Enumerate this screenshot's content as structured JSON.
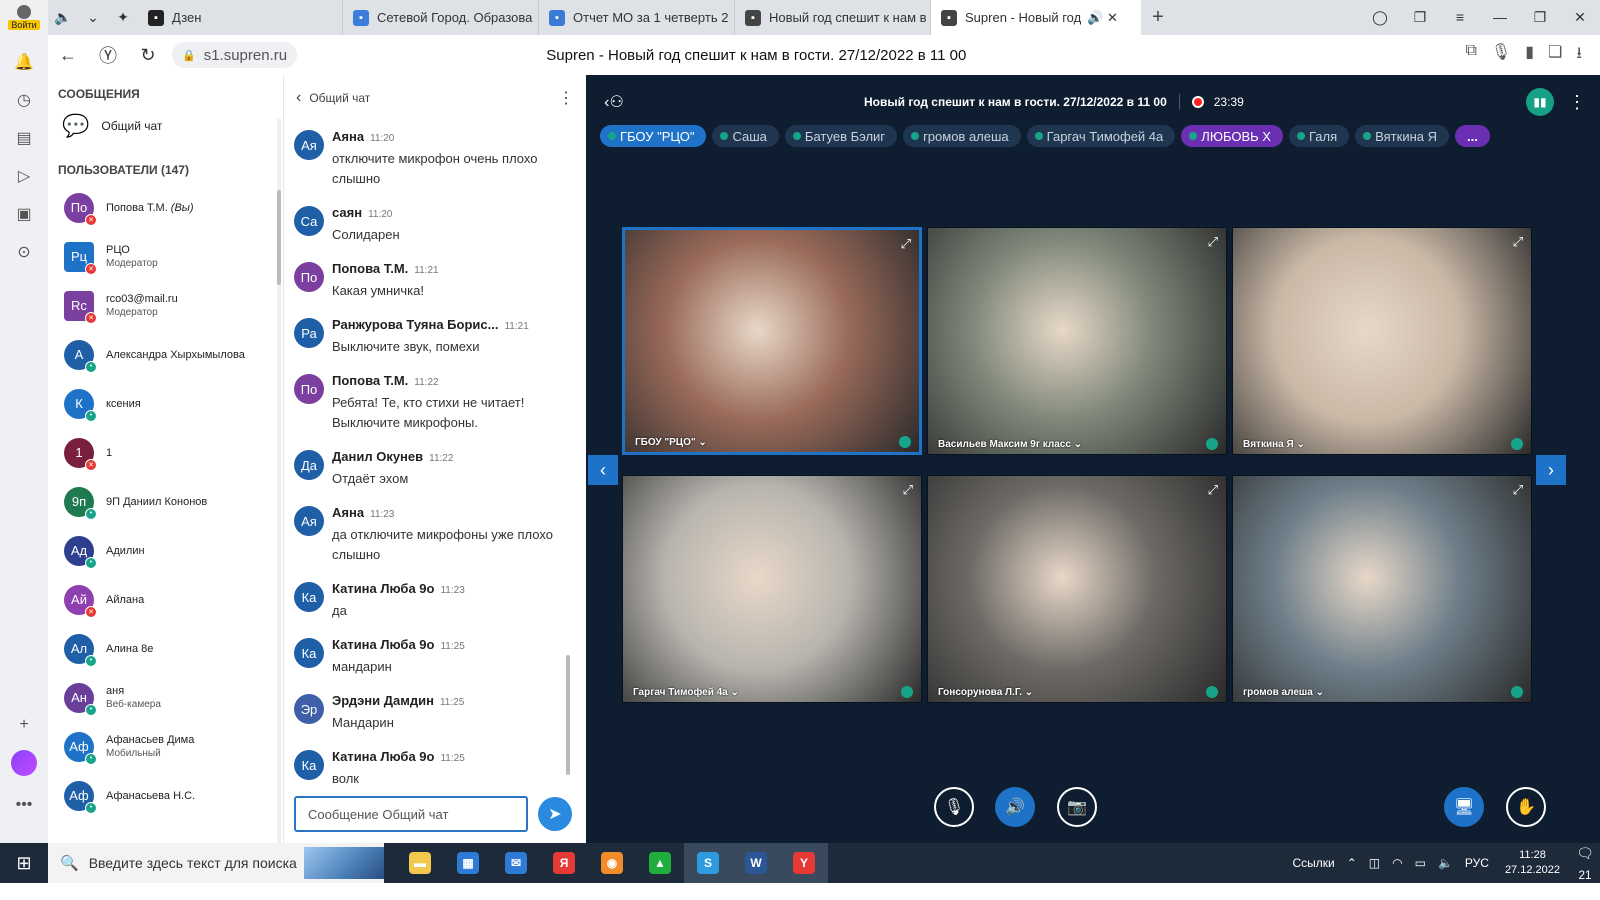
{
  "browser": {
    "profile_label": "Войти",
    "tabs": [
      {
        "label": "Дзен",
        "icon": "dzen-icon",
        "color": "#222222"
      },
      {
        "label": "Сетевой Город. Образова",
        "icon": "netcity-icon",
        "color": "#3b7dd8"
      },
      {
        "label": "Отчет МО за 1 четверть 2",
        "icon": "docs-icon",
        "color": "#3a7bd5"
      },
      {
        "label": "Новый год спешит к нам в",
        "icon": "supren-icon",
        "color": "#444444"
      },
      {
        "label": "Supren - Новый год",
        "icon": "supren-icon",
        "color": "#444444"
      }
    ],
    "url": "s1.supren.ru",
    "page_title": "Supren - Новый год спешит к нам в гости. 27/12/2022 в 11 00"
  },
  "sidebar": {
    "messages_title": "СООБЩЕНИЯ",
    "general_chat": "Общий чат",
    "users_title": "ПОЛЬЗОВАТЕЛИ (147)",
    "users": [
      {
        "initials": "По",
        "name": "Попова Т.М.",
        "suffix": "(Вы)",
        "sub": "",
        "color": "#7b3fa0",
        "badge": "red"
      },
      {
        "initials": "Рц",
        "name": "РЦО",
        "suffix": "",
        "sub": "Модератор",
        "color": "#1e73c8",
        "badge": "red",
        "square": true
      },
      {
        "initials": "Rc",
        "name": "rco03@mail.ru",
        "suffix": "",
        "sub": "Модератор",
        "color": "#7b3fa0",
        "badge": "red",
        "square": true
      },
      {
        "initials": "А",
        "name": "Александра Хырхымылова",
        "suffix": "",
        "sub": "",
        "color": "#1e5fa8",
        "badge": "green"
      },
      {
        "initials": "К",
        "name": "ксения",
        "suffix": "",
        "sub": "",
        "color": "#1e73c8",
        "badge": "green"
      },
      {
        "initials": "1",
        "name": "1",
        "suffix": "",
        "sub": "",
        "color": "#7b1f3f",
        "badge": "red"
      },
      {
        "initials": "9п",
        "name": "9П Даниил Кононов",
        "suffix": "",
        "sub": "",
        "color": "#1f7a4f",
        "badge": "green"
      },
      {
        "initials": "Ад",
        "name": "Адилин",
        "suffix": "",
        "sub": "",
        "color": "#2f3f8f",
        "badge": "green"
      },
      {
        "initials": "Ай",
        "name": "Айлана",
        "suffix": "",
        "sub": "",
        "color": "#8e3fb0",
        "badge": "red"
      },
      {
        "initials": "Ал",
        "name": "Алина 8е",
        "suffix": "",
        "sub": "",
        "color": "#1e5fa8",
        "badge": "green"
      },
      {
        "initials": "Ан",
        "name": "аня",
        "suffix": "",
        "sub": "Веб-камера",
        "color": "#6a3f9a",
        "badge": "green"
      },
      {
        "initials": "Аф",
        "name": "Афанасьев Дима",
        "suffix": "",
        "sub": "Мобильный",
        "color": "#1e73c8",
        "badge": "green"
      },
      {
        "initials": "Аф",
        "name": "Афанасьева Н.С.",
        "suffix": "",
        "sub": "",
        "color": "#1e5fa8",
        "badge": "green"
      }
    ]
  },
  "chat": {
    "title": "Общий чат",
    "input_placeholder": "Сообщение Общий чат",
    "messages": [
      {
        "initials": "Ая",
        "name": "Аяна",
        "time": "11:20",
        "text": "отключите микрофон очень плохо слышно",
        "color": "#1e5fa8"
      },
      {
        "initials": "Са",
        "name": "саян",
        "time": "11:20",
        "text": "Солидарен",
        "color": "#1e5fa8"
      },
      {
        "initials": "По",
        "name": "Попова Т.М.",
        "time": "11:21",
        "text": "Какая умничка!",
        "color": "#7b3fa0"
      },
      {
        "initials": "Ра",
        "name": "Ранжурова Туяна Борис...",
        "time": "11:21",
        "text": "Выключите звук, помехи",
        "color": "#1e5fa8"
      },
      {
        "initials": "По",
        "name": "Попова Т.М.",
        "time": "11:22",
        "text": "Ребята! Те, кто стихи не читает! Выключите микрофоны.",
        "color": "#7b3fa0"
      },
      {
        "initials": "Да",
        "name": "Данил Окунев",
        "time": "11:22",
        "text": "Отдаёт эхом",
        "color": "#1e5fa8"
      },
      {
        "initials": "Ая",
        "name": "Аяна",
        "time": "11:23",
        "text": "да отключите микрофоны уже плохо слышно",
        "color": "#1e5fa8"
      },
      {
        "initials": "Ка",
        "name": "Катина Люба 9о",
        "time": "11:23",
        "text": "да",
        "color": "#1e5fa8"
      },
      {
        "initials": "Ка",
        "name": "Катина Люба 9о",
        "time": "11:25",
        "text": "мандарин",
        "color": "#1e5fa8"
      },
      {
        "initials": "Эр",
        "name": "Эрдэни Дамдин",
        "time": "11:25",
        "text": "Мандарин",
        "color": "#3f5fa8"
      },
      {
        "initials": "Ка",
        "name": "Катина Люба 9о",
        "time": "11:25",
        "text": "волк",
        "color": "#1e5fa8"
      }
    ]
  },
  "conference": {
    "title": "Новый год спешит к нам в гости. 27/12/2022 в 11 00",
    "rec_time": "23:39",
    "chips": [
      {
        "label": "ГБОУ \"РЦО\"",
        "style": "blue"
      },
      {
        "label": "Саша",
        "style": ""
      },
      {
        "label": "Батуев Бэлиг",
        "style": ""
      },
      {
        "label": "громов алеша",
        "style": ""
      },
      {
        "label": "Гаргач Тимофей 4а",
        "style": ""
      },
      {
        "label": "ЛЮБОВЬ Х",
        "style": "purple"
      },
      {
        "label": "Галя",
        "style": ""
      },
      {
        "label": "Вяткина Я",
        "style": ""
      }
    ],
    "more_label": "...",
    "tiles": [
      {
        "label": "ГБОУ \"РЦО\" ⌄",
        "bg": "#9a6a5a",
        "selected": true
      },
      {
        "label": "Васильев Максим 9г класс ⌄",
        "bg": "#7d8678"
      },
      {
        "label": "Вяткина Я ⌄",
        "bg": "#c9b8a6"
      },
      {
        "label": "Гаргач Тимофей 4а ⌄",
        "bg": "#b7b4ae"
      },
      {
        "label": "Гонсорунова Л.Г. ⌄",
        "bg": "#6d6a66"
      },
      {
        "label": "громов алеша ⌄",
        "bg": "#6e7f8a"
      }
    ]
  },
  "taskbar": {
    "search_placeholder": "Введите здесь текст для поиска",
    "links_label": "Ссылки",
    "lang": "РУС",
    "time": "11:28",
    "date": "27.12.2022",
    "notif_count": "21",
    "apps": [
      {
        "name": "explorer",
        "color": "#f2c94c",
        "glyph": "▬"
      },
      {
        "name": "store",
        "color": "#2d7bd6",
        "glyph": "▦"
      },
      {
        "name": "mail",
        "color": "#2d7bd6",
        "glyph": "✉"
      },
      {
        "name": "yandex-browser",
        "color": "#e53935",
        "glyph": "Я"
      },
      {
        "name": "browser-round",
        "color": "#f28c28",
        "glyph": "◉"
      },
      {
        "name": "green-app",
        "color": "#1fae3b",
        "glyph": "▲"
      },
      {
        "name": "skype",
        "color": "#2d9be0",
        "glyph": "S"
      },
      {
        "name": "word",
        "color": "#2b5797",
        "glyph": "W"
      },
      {
        "name": "yandex",
        "color": "#e53935",
        "glyph": "Y"
      }
    ]
  }
}
